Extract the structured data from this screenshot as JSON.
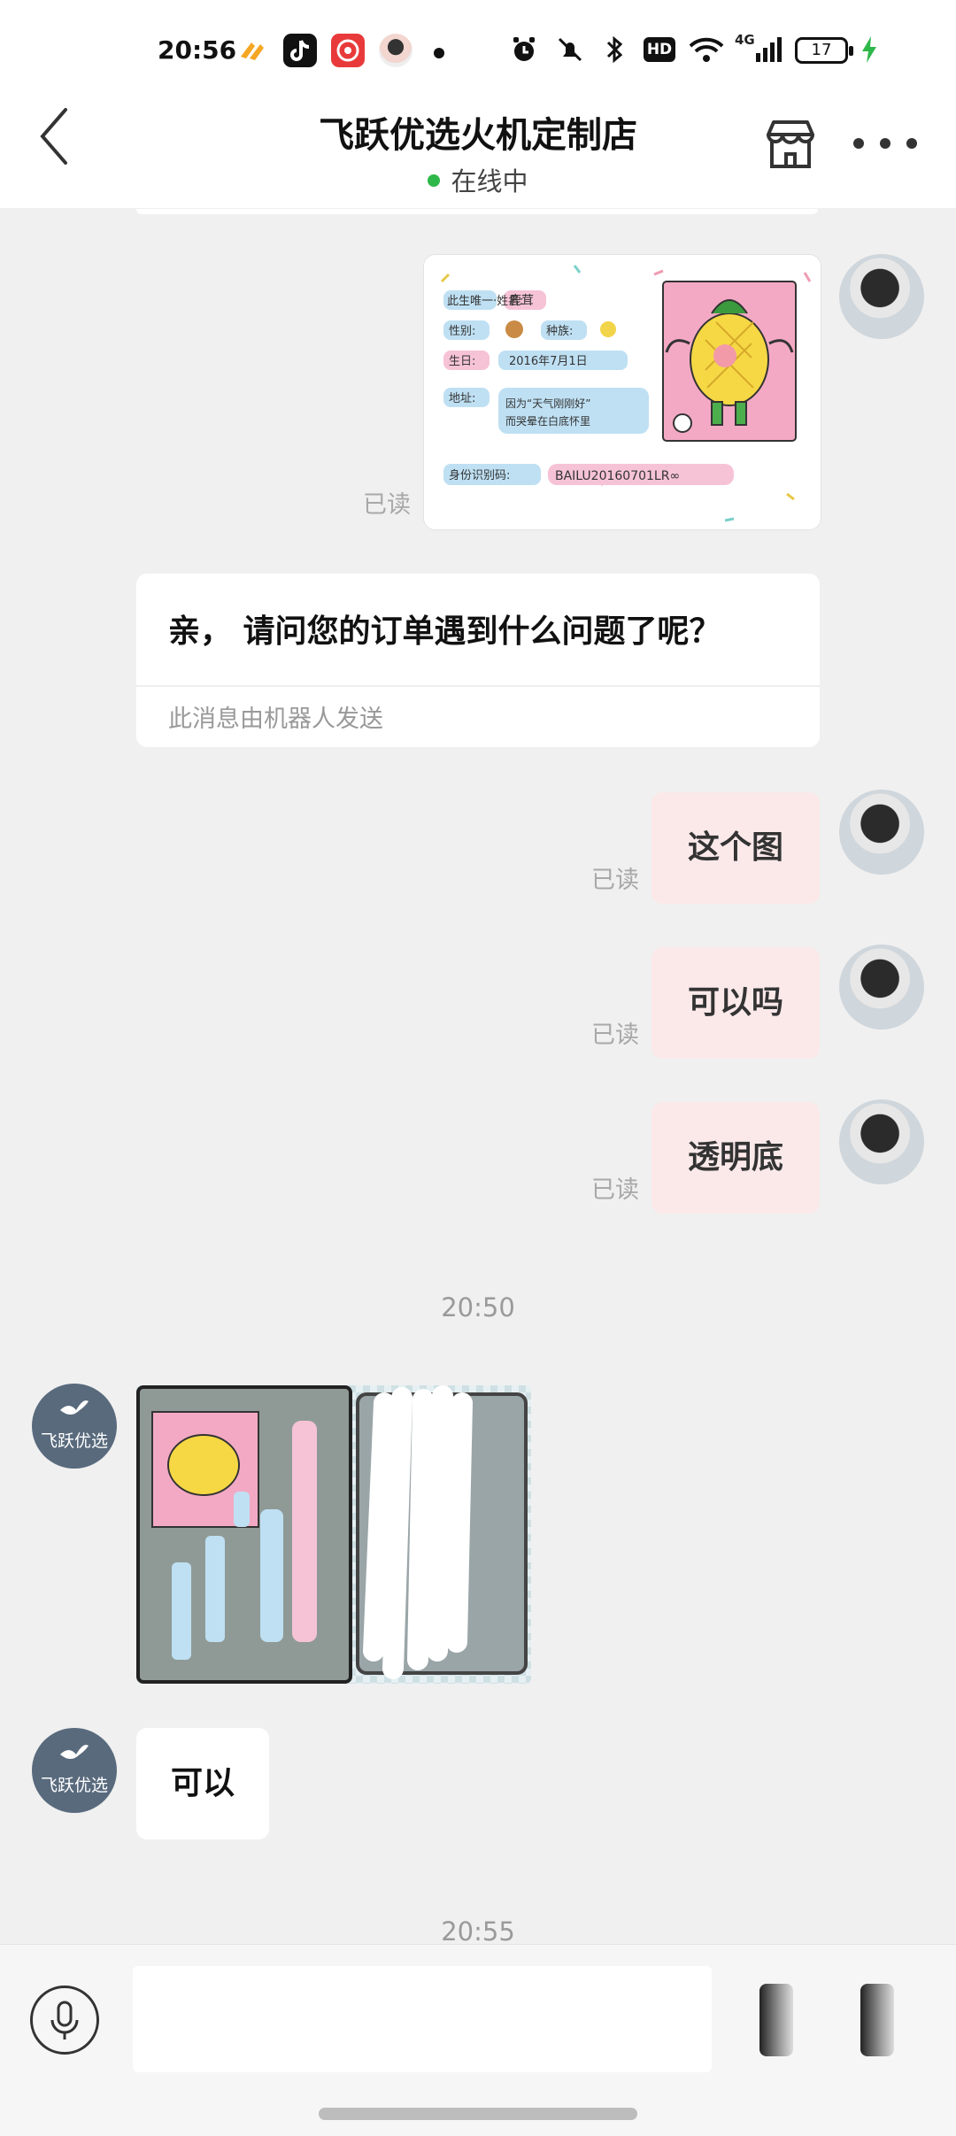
{
  "status_bar": {
    "time": "20:56",
    "battery": "17",
    "network": "4G",
    "hd": "HD",
    "icons": [
      "app-icon-orange",
      "tiktok-icon",
      "app-icon-red",
      "avatar-app-icon",
      "alarm-icon",
      "mute-icon",
      "bluetooth-icon",
      "hd-icon",
      "wifi-icon",
      "signal-icon",
      "battery-icon",
      "charging-icon"
    ]
  },
  "header": {
    "title": "飞跃优选火机定制店",
    "status": "在线中",
    "status_color": "#2fb84a"
  },
  "messages": {
    "img1_read": "已读",
    "robot_question": "亲， 请问您的订单遇到什么问题了呢？",
    "robot_footer": "此消息由机器人发送",
    "msg1": "这个图",
    "msg1_read": "已读",
    "msg2": "可以吗",
    "msg2_read": "已读",
    "msg3": "透明底",
    "msg3_read": "已读",
    "time1": "20:50",
    "shop_avatar_name": "飞跃优选",
    "shop_reply": "可以",
    "time2": "20:55"
  },
  "sticker": {
    "row1": "此生唯一·姓名:",
    "name": "鹿茸",
    "gender": "性别:",
    "species": "种族:",
    "birthday_label": "生日:",
    "birthday": "2016年7月1日",
    "address_label": "地址:",
    "address_line1": "因为“天气刚刚好”",
    "address_line2": "而哭晕在白底怀里",
    "id_label": "身份识别码:",
    "id_code": "BAILU20160701LR∞"
  },
  "colors": {
    "bubble_right": "#fbe9ea",
    "bubble_left": "#ffffff",
    "background": "#f0f0f0",
    "shop_avatar": "#596a7d"
  }
}
